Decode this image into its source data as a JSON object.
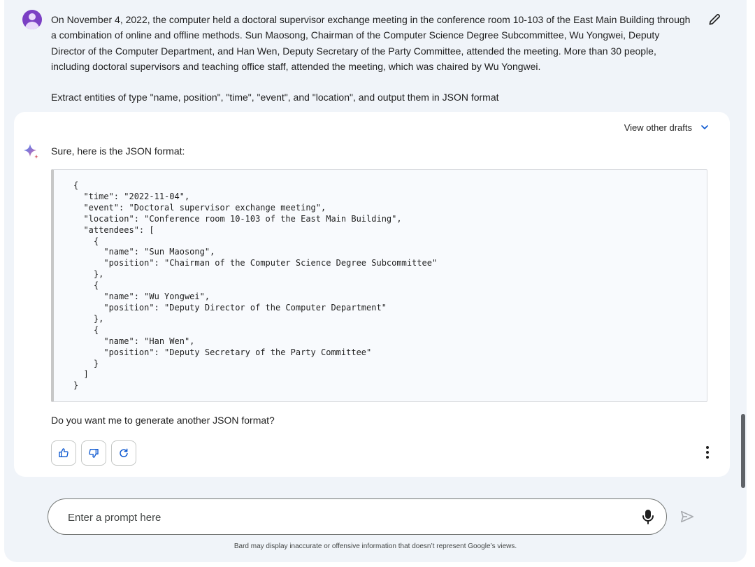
{
  "user_message": {
    "paragraph": "On November 4, 2022, the computer held a doctoral supervisor exchange meeting in the conference room 10-103 of the East Main Building through a combination of online and offline methods. Sun Maosong, Chairman of the Computer Science Degree Subcommittee, Wu Yongwei, Deputy Director of the Computer Department, and Han Wen, Deputy Secretary of the Party Committee, attended the meeting. More than 30 people, including doctoral supervisors and teaching office staff, attended the meeting, which was chaired by Wu Yongwei.",
    "instruction": "Extract entities of type \"name, position\", \"time\", \"event\", and \"location\", and output them in JSON format",
    "edit_icon": "pencil-icon"
  },
  "response": {
    "view_drafts_label": "View other drafts",
    "intro": "Sure, here is the JSON format:",
    "code": "{\n  \"time\": \"2022-11-04\",\n  \"event\": \"Doctoral supervisor exchange meeting\",\n  \"location\": \"Conference room 10-103 of the East Main Building\",\n  \"attendees\": [\n    {\n      \"name\": \"Sun Maosong\",\n      \"position\": \"Chairman of the Computer Science Degree Subcommittee\"\n    },\n    {\n      \"name\": \"Wu Yongwei\",\n      \"position\": \"Deputy Director of the Computer Department\"\n    },\n    {\n      \"name\": \"Han Wen\",\n      \"position\": \"Deputy Secretary of the Party Committee\"\n    }\n  ]\n}",
    "follow_up": "Do you want me to generate another JSON format?",
    "actions": [
      "thumbs-up-icon",
      "thumbs-down-icon",
      "regenerate-icon",
      "more-vert-icon"
    ]
  },
  "prompt": {
    "placeholder": "Enter a prompt here",
    "mic_icon": "mic-icon",
    "send_icon": "send-icon"
  },
  "disclaimer": "Bard may display inaccurate or offensive information that doesn’t represent Google’s views.",
  "colors": {
    "background": "#f0f4f9",
    "card": "#ffffff",
    "accent_blue": "#0b57d0",
    "avatar_purple": "#7b3fc4"
  }
}
